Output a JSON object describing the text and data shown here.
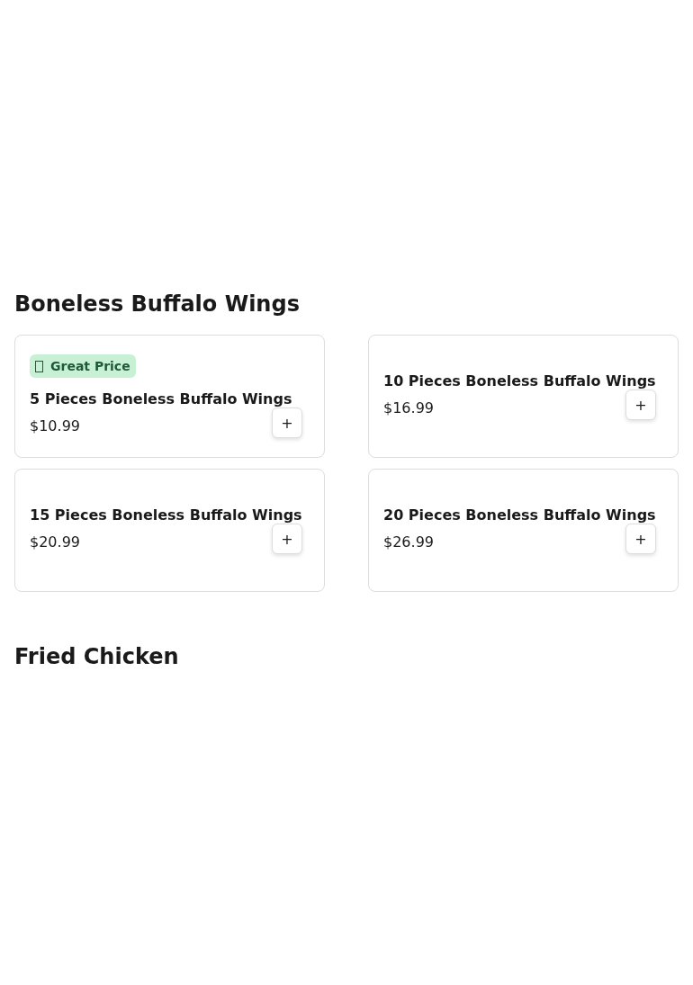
{
  "sections": [
    {
      "title": "Boneless Buffalo Wings",
      "items": [
        {
          "badge": "Great Price",
          "name": "5 Pieces Boneless Buffalo Wings",
          "price": "$10.99",
          "button": "+"
        },
        {
          "name": "10 Pieces Boneless Buffalo Wings",
          "price": "$16.99",
          "button": "+"
        },
        {
          "name": "15 Pieces Boneless Buffalo Wings",
          "price": "$20.99",
          "button": "+"
        },
        {
          "name": "20 Pieces Boneless Buffalo Wings",
          "price": "$26.99",
          "button": "+"
        }
      ]
    },
    {
      "title": "Fried Chicken"
    }
  ]
}
